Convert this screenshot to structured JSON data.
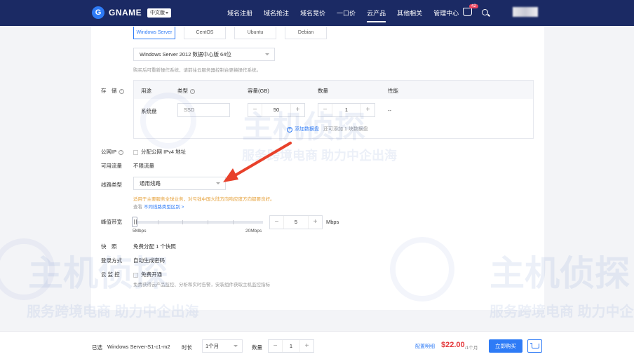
{
  "header": {
    "logo_glyph": "G",
    "brand": "GNAME",
    "language": "中文版",
    "nav": [
      "域名注册",
      "域名抢注",
      "域名竞价",
      "一口价",
      "云产品",
      "其他相关",
      "管理中心"
    ],
    "cart_badge": "42"
  },
  "os_tabs": [
    "Windows Server",
    "CentOS",
    "Ubuntu",
    "Debian"
  ],
  "image_select": "Windows Server 2012 数据中心版 64位",
  "image_hint": "购买后可重新操作系统，请前往云服务器控制台更换操作系统。",
  "storage": {
    "label": "存　储",
    "headers": [
      "用途",
      "类型",
      "容量(GB)",
      "数量",
      "性能"
    ],
    "row": {
      "usage": "系统盘",
      "type": "SSD",
      "capacity": "50",
      "count": "1",
      "performance": "--"
    },
    "add_link": "添加数据盘",
    "add_hint": "还可添加 1 块数据盘"
  },
  "public_ip": {
    "label": "公网IP",
    "option": "分配公网 IPv4 地址"
  },
  "traffic": {
    "label": "可用流量",
    "value": "不限流量"
  },
  "line": {
    "label": "线路类型",
    "value": "通用线路",
    "hint": "适用于主要服务全球业务，对亏钱中国大陆方向响应度方向都要良好。",
    "link_prefix": "查看",
    "link": "不同线路类型区别 >"
  },
  "bandwidth": {
    "label": "峰值带宽",
    "min_label": "5Mbps",
    "max_label": "20Mbps",
    "value": "5",
    "unit": "Mbps",
    "slider_level": 0
  },
  "snapshot": {
    "label": "快　照",
    "value": "免费分配 1 个快照"
  },
  "login": {
    "label": "登录方式",
    "value": "自动生成密码"
  },
  "monitor": {
    "label": "云 监 控",
    "option": "免费开通",
    "hint": "免费获得云产品监控、分析和实时告警，安装组件获取主机监控指标"
  },
  "bottom": {
    "selected_label": "已选",
    "selected_value": "Windows Server-S1-c1-m2",
    "duration_label": "时长",
    "duration_value": "1个月",
    "qty_label": "数量",
    "qty_value": "1",
    "config_link": "配置明细",
    "price": "$22.00",
    "per": "/1个月",
    "buy": "立即购买"
  },
  "watermark": {
    "brand": "主机侦探",
    "slogan": "服务跨境电商 助力中企出海"
  },
  "colors": {
    "header": "#1b2a64",
    "accent": "#2e7bf6",
    "price": "#e4393c",
    "arrow": "#e8412b",
    "warning": "#e6a23c"
  }
}
